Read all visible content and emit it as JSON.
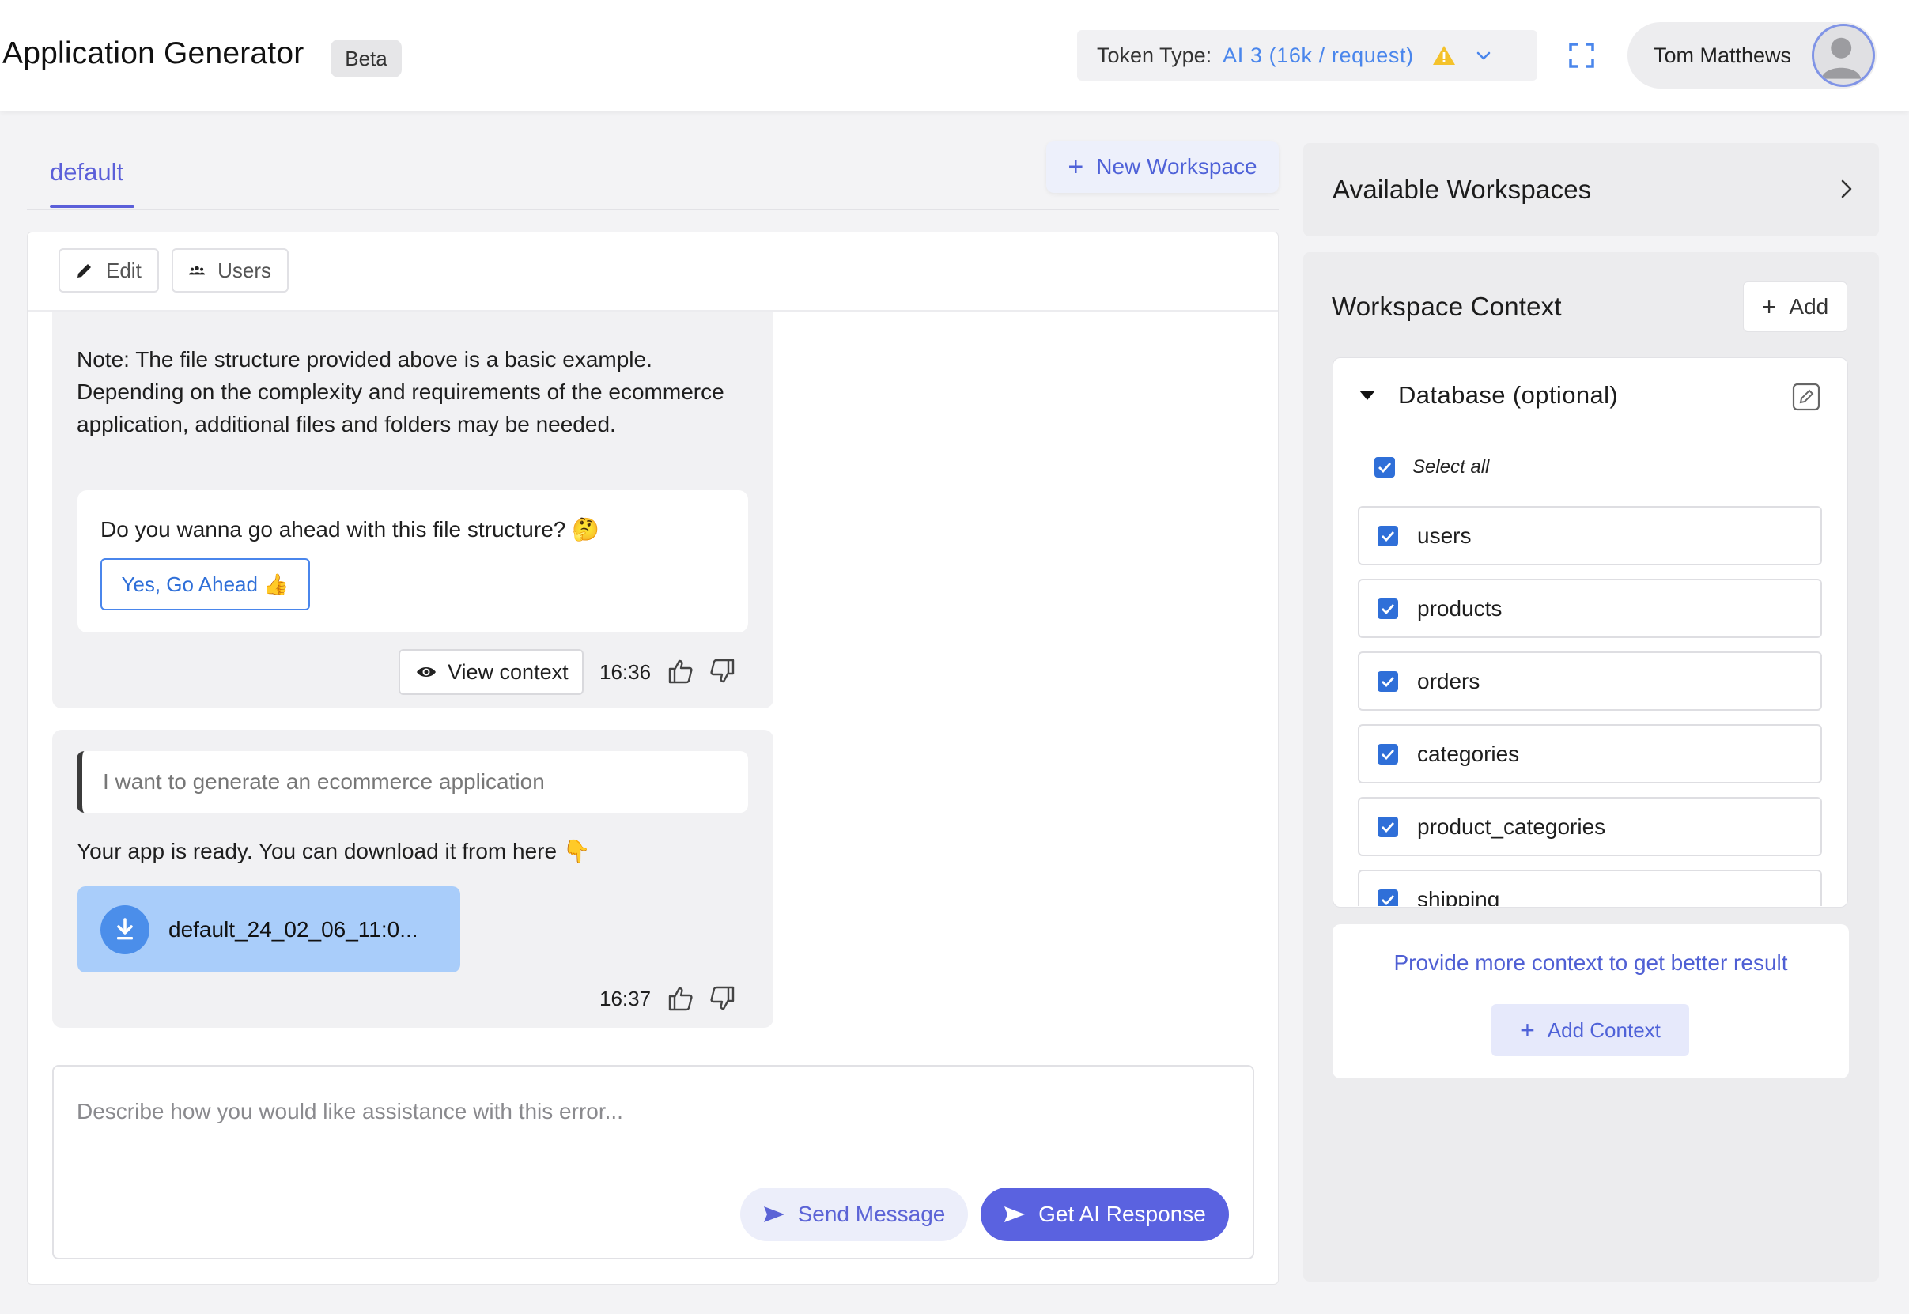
{
  "header": {
    "title": "Application Generator",
    "badge": "Beta",
    "token_label": "Token Type:",
    "token_value": "AI 3 (16k / request)",
    "user_name": "Tom Matthews"
  },
  "tabs": {
    "active": "default",
    "new_workspace": "New Workspace"
  },
  "toolbar": {
    "edit_label": "Edit",
    "users_label": "Users"
  },
  "chat": {
    "message1": {
      "note": "Note: The file structure provided above is a basic example. Depending on the complexity and requirements of the ecommerce application, additional files and folders may be needed.",
      "question": "Do you wanna go ahead with this file structure? 🤔",
      "confirm_button": "Yes, Go Ahead 👍",
      "view_context": "View context",
      "time": "16:36"
    },
    "message2": {
      "quote": "I want to generate an ecommerce application",
      "reply": "Your app is ready. You can download it from here 👇",
      "file_name": "default_24_02_06_11:0...",
      "time": "16:37"
    }
  },
  "composer": {
    "placeholder": "Describe how you would like assistance with this error...",
    "send_label": "Send Message",
    "ai_label": "Get AI Response"
  },
  "sidebar": {
    "available_title": "Available Workspaces",
    "context_title": "Workspace Context",
    "add_label": "Add",
    "database_title": "Database (optional)",
    "select_all": "Select all",
    "tables": [
      "users",
      "products",
      "orders",
      "categories",
      "product_categories",
      "shipping"
    ],
    "hint": "Provide more context to get better result",
    "add_context": "Add Context"
  },
  "colors": {
    "accent": "#5a62e0",
    "link_blue": "#4a86ec",
    "checkbox_blue": "#2f6fd8",
    "warning": "#f4c22b"
  },
  "icons": [
    "warning-icon",
    "chevron-down-icon",
    "fullscreen-icon",
    "avatar-icon",
    "plus-icon",
    "pencil-icon",
    "users-icon",
    "eye-icon",
    "thumbs-up-icon",
    "thumbs-down-icon",
    "download-icon",
    "send-icon",
    "chevron-right-icon",
    "caret-down-icon",
    "edit-icon",
    "checkbox-icon"
  ]
}
